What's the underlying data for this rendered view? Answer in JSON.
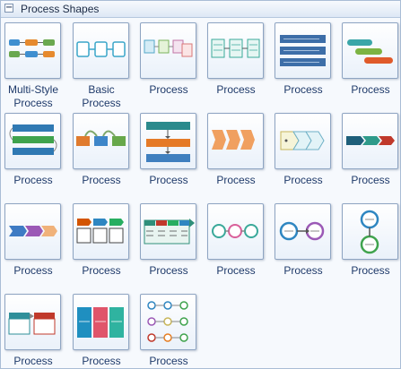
{
  "panel": {
    "title": "Process Shapes",
    "collapse_glyph": "−"
  },
  "shapes": [
    {
      "label": "Multi-Style\nProcess",
      "icon": "multi-style-process-icon"
    },
    {
      "label": "Basic\nProcess",
      "icon": "basic-process-icon"
    },
    {
      "label": "Process",
      "icon": "process-icon-1"
    },
    {
      "label": "Process",
      "icon": "process-icon-2"
    },
    {
      "label": "Process",
      "icon": "process-icon-3"
    },
    {
      "label": "Process",
      "icon": "process-icon-4"
    },
    {
      "label": "Process",
      "icon": "process-icon-5"
    },
    {
      "label": "Process",
      "icon": "process-icon-6"
    },
    {
      "label": "Process",
      "icon": "process-icon-7"
    },
    {
      "label": "Process",
      "icon": "process-icon-8"
    },
    {
      "label": "Process",
      "icon": "process-icon-9"
    },
    {
      "label": "Process",
      "icon": "process-icon-10"
    },
    {
      "label": "Process",
      "icon": "process-icon-11"
    },
    {
      "label": "Process",
      "icon": "process-icon-12"
    },
    {
      "label": "Process",
      "icon": "process-icon-13"
    },
    {
      "label": "Process",
      "icon": "process-icon-14"
    },
    {
      "label": "Process",
      "icon": "process-icon-15"
    },
    {
      "label": "Process",
      "icon": "process-icon-16"
    },
    {
      "label": "Process",
      "icon": "process-icon-17"
    },
    {
      "label": "Process",
      "icon": "process-icon-18"
    },
    {
      "label": "Process",
      "icon": "process-icon-19"
    }
  ]
}
